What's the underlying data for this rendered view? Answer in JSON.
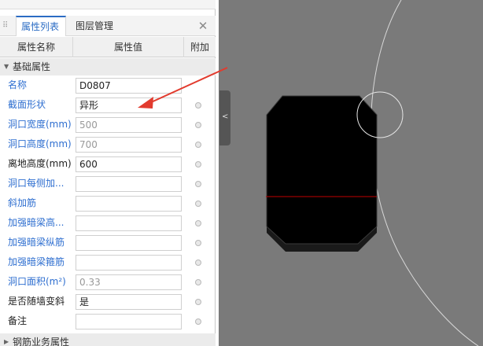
{
  "tabs": {
    "attr_list": "属性列表",
    "layer_mgmt": "图层管理"
  },
  "columns": {
    "name": "属性名称",
    "value": "属性值",
    "add": "附加"
  },
  "groups": {
    "basic": "基础属性",
    "rebar": "钢筋业务属性"
  },
  "rows": [
    {
      "name": "名称",
      "value": "D0807"
    },
    {
      "name": "截面形状",
      "value": "异形"
    },
    {
      "name": "洞口宽度(mm)",
      "value": "500"
    },
    {
      "name": "洞口高度(mm)",
      "value": "700"
    },
    {
      "name": "离地高度(mm)",
      "value": "600"
    },
    {
      "name": "洞口每侧加...",
      "value": ""
    },
    {
      "name": "斜加筋",
      "value": ""
    },
    {
      "name": "加强暗梁高...",
      "value": ""
    },
    {
      "name": "加强暗梁纵筋",
      "value": ""
    },
    {
      "name": "加强暗梁箍筋",
      "value": ""
    },
    {
      "name": "洞口面积(m²)",
      "value": "0.33"
    },
    {
      "name": "是否随墙变斜",
      "value": "是"
    },
    {
      "name": "备注",
      "value": ""
    }
  ],
  "icons": {
    "close": "close-icon",
    "grip": "drag-grip-icon",
    "collapse": "chevron-left-icon",
    "expand": "triangle-down-icon",
    "collapsed": "triangle-right-icon"
  },
  "colors": {
    "accent": "#2b6cc4",
    "annotation_arrow": "#e23b2e",
    "canvas_bg": "#7a7a7a",
    "shape_fill": "#000000",
    "shape_line": "#c00000"
  }
}
